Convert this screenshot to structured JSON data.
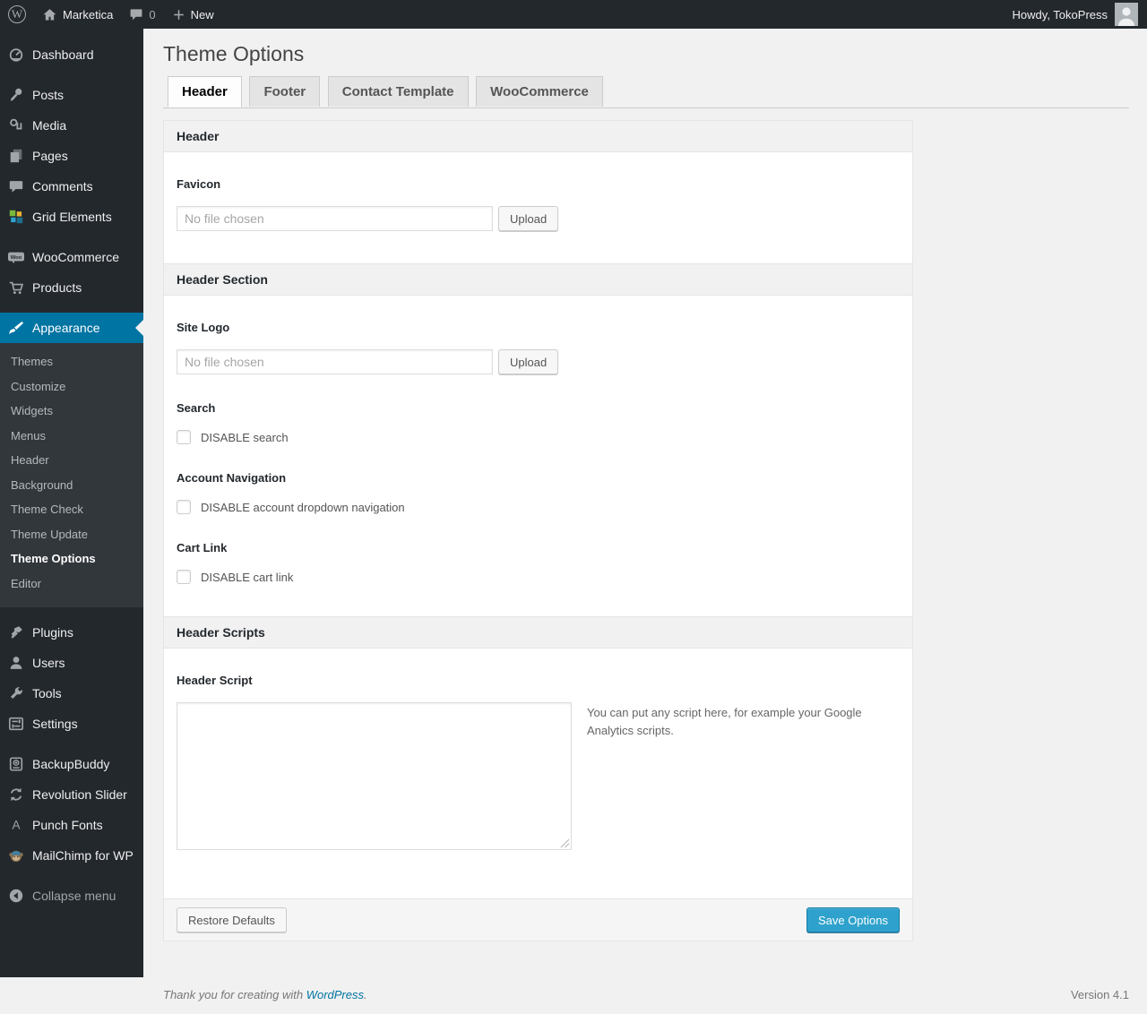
{
  "colors": {
    "accent": "#0074a2",
    "admin_bar_bg": "#23282d",
    "menu_bg": "#23282d",
    "submenu_bg": "#32373c",
    "page_bg": "#f1f1f1",
    "primary_button_bg": "#2ea2cc",
    "link": "#0074a2"
  },
  "admin_bar": {
    "site_name": "Marketica",
    "comment_count": "0",
    "new_label": "New",
    "howdy": "Howdy, TokoPress"
  },
  "sidebar": {
    "items": [
      {
        "label": "Dashboard",
        "icon": "dashboard-icon"
      },
      {
        "label": "Posts",
        "icon": "pushpin-icon"
      },
      {
        "label": "Media",
        "icon": "media-icon"
      },
      {
        "label": "Pages",
        "icon": "pages-icon"
      },
      {
        "label": "Comments",
        "icon": "comments-icon"
      },
      {
        "label": "Grid Elements",
        "icon": "grid-icon"
      },
      {
        "label": "WooCommerce",
        "icon": "woo-badge-icon"
      },
      {
        "label": "Products",
        "icon": "cart-icon"
      },
      {
        "label": "Appearance",
        "icon": "paintbrush-icon"
      },
      {
        "label": "Plugins",
        "icon": "plugin-icon"
      },
      {
        "label": "Users",
        "icon": "user-icon"
      },
      {
        "label": "Tools",
        "icon": "wrench-icon"
      },
      {
        "label": "Settings",
        "icon": "sliders-icon"
      },
      {
        "label": "BackupBuddy",
        "icon": "backup-drive-icon"
      },
      {
        "label": "Revolution Slider",
        "icon": "refresh-arrows-icon"
      },
      {
        "label": "Punch Fonts",
        "icon": "letter-a-icon"
      },
      {
        "label": "MailChimp for WP",
        "icon": "monkey-icon"
      },
      {
        "label": "Collapse menu",
        "icon": "collapse-arrow-icon"
      }
    ],
    "submenu": [
      "Themes",
      "Customize",
      "Widgets",
      "Menus",
      "Header",
      "Background",
      "Theme Check",
      "Theme Update",
      "Theme Options",
      "Editor"
    ],
    "active_item": "Appearance",
    "active_submenu": "Theme Options"
  },
  "page": {
    "title": "Theme Options",
    "tabs": [
      {
        "label": "Header"
      },
      {
        "label": "Footer"
      },
      {
        "label": "Contact Template"
      },
      {
        "label": "WooCommerce"
      }
    ],
    "active_tab": "Header"
  },
  "panel": {
    "sections": [
      {
        "title": "Header"
      },
      {
        "title": "Header Section"
      },
      {
        "title": "Header Scripts"
      }
    ],
    "fields": {
      "favicon": {
        "label": "Favicon",
        "placeholder": "No file chosen",
        "button": "Upload"
      },
      "site_logo": {
        "label": "Site Logo",
        "placeholder": "No file chosen",
        "button": "Upload"
      },
      "search": {
        "label": "Search",
        "checkbox_label": "DISABLE search",
        "checked": false
      },
      "account_nav": {
        "label": "Account Navigation",
        "checkbox_label": "DISABLE account dropdown navigation",
        "checked": false
      },
      "cart_link": {
        "label": "Cart Link",
        "checkbox_label": "DISABLE cart link",
        "checked": false
      },
      "header_script": {
        "label": "Header Script",
        "value": "",
        "help": "You can put any script here, for example your Google Analytics scripts."
      }
    },
    "restore_button": "Restore Defaults",
    "save_button": "Save Options"
  },
  "footer": {
    "thanks_prefix": "Thank you for creating with ",
    "wordpress_link": "WordPress",
    "thanks_suffix": ".",
    "version": "Version 4.1"
  }
}
